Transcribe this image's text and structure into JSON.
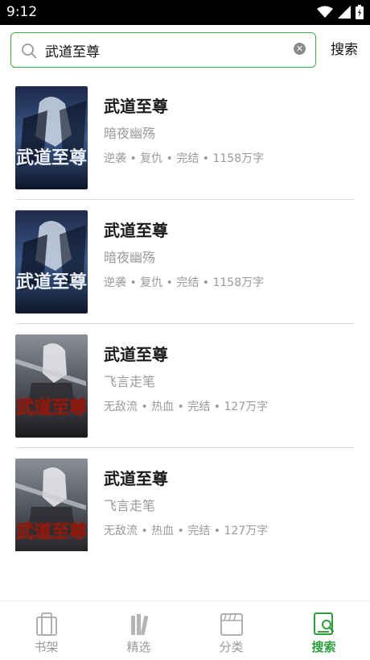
{
  "status_bar": {
    "time": "9:12",
    "icons": [
      "wifi-icon",
      "signal-icon",
      "battery-icon"
    ]
  },
  "search": {
    "query": "武道至尊",
    "button_label": "搜索",
    "accent_color": "#3fae49"
  },
  "results": [
    {
      "title": "武道至尊",
      "author": "暗夜幽殇",
      "meta": "逆袭 • 复仇 • 完结 • 1158万字",
      "cover_text": "武道至尊"
    },
    {
      "title": "武道至尊",
      "author": "暗夜幽殇",
      "meta": "逆袭 • 复仇 • 完结 • 1158万字",
      "cover_text": "武道至尊"
    },
    {
      "title": "武道至尊",
      "author": "飞言走笔",
      "meta": "无敌流 • 热血 • 完结 • 127万字",
      "cover_text": "武道至尊"
    },
    {
      "title": "武道至尊",
      "author": "飞言走笔",
      "meta": "无敌流 • 热血 • 完结 • 127万字",
      "cover_text": "武道至尊"
    }
  ],
  "bottom_nav": {
    "active_color": "#2e9e3c",
    "items": [
      {
        "label": "书架",
        "icon": "bookshelf-icon",
        "active": false
      },
      {
        "label": "精选",
        "icon": "books-icon",
        "active": false
      },
      {
        "label": "分类",
        "icon": "category-icon",
        "active": false
      },
      {
        "label": "搜索",
        "icon": "search-tab-icon",
        "active": true
      }
    ]
  }
}
